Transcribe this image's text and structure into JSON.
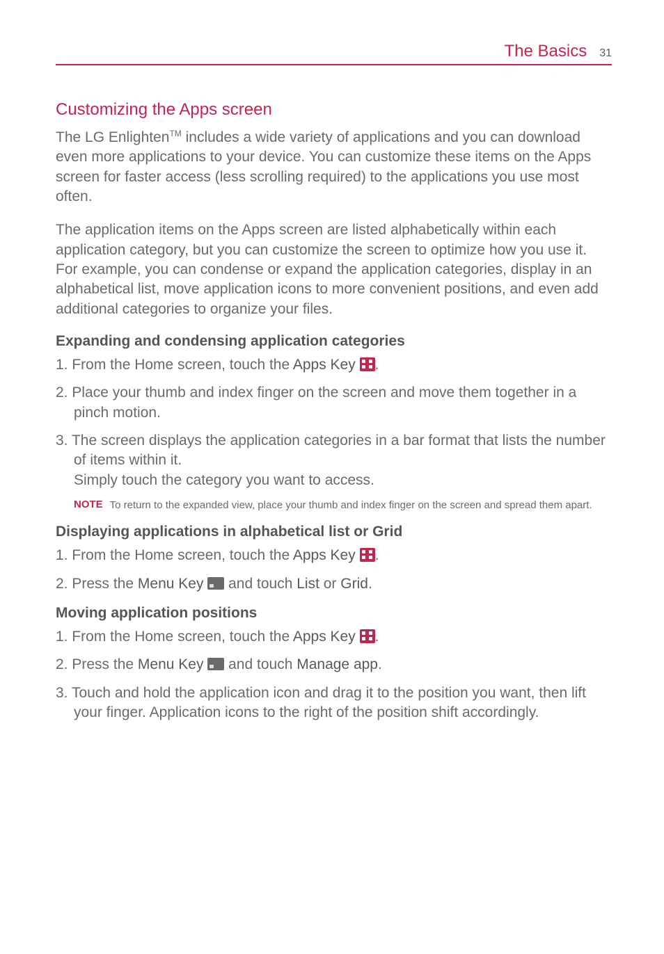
{
  "header": {
    "title": "The Basics",
    "page": "31"
  },
  "section1": {
    "title": "Customizing the Apps screen",
    "p1_pre": "The LG Enlighten",
    "p1_sup": "TM",
    "p1_post": " includes a wide variety of applications and you can download even more applications to your device. You can customize these items on the Apps screen for faster access (less scrolling required) to the applications you use most often.",
    "p2": "The application items on the Apps screen are listed alphabetically within each application category, but you can customize the screen to optimize how you use it. For example, you can condense or expand the application categories, display in an alphabetical list, move application icons to more convenient positions, and even add additional categories to organize your files."
  },
  "section2": {
    "title": "Expanding and condensing application categories",
    "item1_num": "1. ",
    "item1_pre": "From the Home screen, touch the ",
    "item1_bold": "Apps Key ",
    "item1_post": ".",
    "item2_num": "2. ",
    "item2": "Place your thumb and index finger on the screen and move them together in a pinch motion.",
    "item3_num": "3. ",
    "item3_line1": "The screen displays the application categories in a bar format that lists the number of items within it.",
    "item3_line2": "Simply touch the category you want to access.",
    "note_label": "NOTE",
    "note_text": "To return to the expanded view, place your thumb and index finger on the screen and spread them apart."
  },
  "section3": {
    "title": "Displaying applications in alphabetical list or Grid",
    "item1_num": "1. ",
    "item1_pre": "From the Home screen, touch the ",
    "item1_bold": "Apps Key ",
    "item1_post": ".",
    "item2_num": "2. ",
    "item2_pre": "Press the ",
    "item2_bold1": "Menu Key ",
    "item2_mid": " and touch ",
    "item2_bold2": "List",
    "item2_or": " or ",
    "item2_bold3": "Grid",
    "item2_post": "."
  },
  "section4": {
    "title": "Moving application positions",
    "item1_num": "1. ",
    "item1_pre": "From the Home screen, touch the ",
    "item1_bold": "Apps Key ",
    "item1_post": ".",
    "item2_num": "2. ",
    "item2_pre": "Press the ",
    "item2_bold1": "Menu Key ",
    "item2_mid": " and touch ",
    "item2_bold2": "Manage app",
    "item2_post": ".",
    "item3_num": "3. ",
    "item3": "Touch and hold the application icon and drag it to the position you want, then lift your finger. Application icons to the right of the position shift accordingly."
  }
}
